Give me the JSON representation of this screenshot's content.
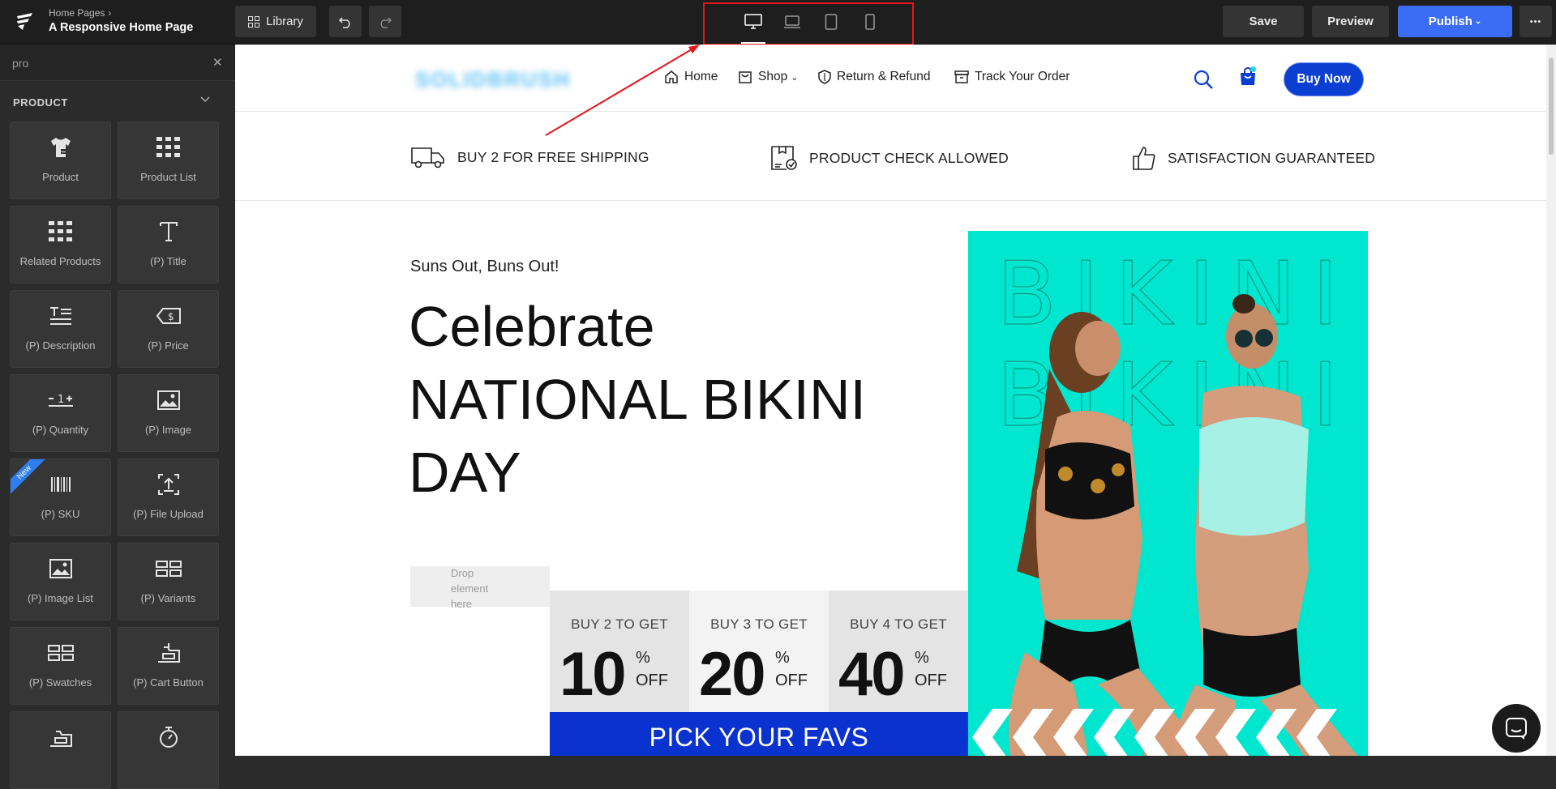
{
  "topbar": {
    "breadcrumb": "Home Pages",
    "title": "A Responsive Home Page",
    "library_label": "Library",
    "devices": [
      "desktop",
      "laptop",
      "tablet",
      "mobile"
    ],
    "active_device": "desktop",
    "save_label": "Save",
    "preview_label": "Preview",
    "publish_label": "Publish",
    "more_label": "•••"
  },
  "sidebar": {
    "search_value": "pro",
    "section_title": "PRODUCT",
    "tiles": [
      {
        "label": "Product",
        "icon": "tshirt-icon"
      },
      {
        "label": "Product List",
        "icon": "grid-list-icon"
      },
      {
        "label": "Related Products",
        "icon": "grid-icon"
      },
      {
        "label": "(P) Title",
        "icon": "title-icon"
      },
      {
        "label": "(P) Description",
        "icon": "description-icon"
      },
      {
        "label": "(P) Price",
        "icon": "price-tag-icon"
      },
      {
        "label": "(P) Quantity",
        "icon": "quantity-icon"
      },
      {
        "label": "(P) Image",
        "icon": "image-icon"
      },
      {
        "label": "(P) SKU",
        "icon": "barcode-icon",
        "badge": "New"
      },
      {
        "label": "(P) File Upload",
        "icon": "upload-icon"
      },
      {
        "label": "(P) Image List",
        "icon": "image-list-icon"
      },
      {
        "label": "(P) Variants",
        "icon": "variants-icon"
      },
      {
        "label": "(P) Swatches",
        "icon": "swatches-icon"
      },
      {
        "label": "(P) Cart Button",
        "icon": "cart-icon"
      },
      {
        "label": "",
        "icon": "cart-icon"
      },
      {
        "label": "",
        "icon": "timer-icon"
      }
    ]
  },
  "page": {
    "brand": "SOLIDBRUSH",
    "nav": {
      "home": "Home",
      "shop": "Shop",
      "return": "Return & Refund",
      "track": "Track Your Order"
    },
    "buy_now": "Buy Now",
    "features": [
      "BUY 2 FOR FREE SHIPPING",
      "PRODUCT CHECK ALLOWED",
      "SATISFACTION GUARANTEED"
    ],
    "kicker": "Suns Out, Buns Out!",
    "headline_lines": [
      "Celebrate",
      "NATIONAL BIKINI",
      "DAY"
    ],
    "drop_text": "Drop element here",
    "offers": [
      {
        "title": "BUY 2 TO GET",
        "value": "10",
        "pct": "%",
        "off": "OFF"
      },
      {
        "title": "BUY 3 TO GET",
        "value": "20",
        "pct": "%",
        "off": "OFF"
      },
      {
        "title": "BUY 4 TO GET",
        "value": "40",
        "pct": "%",
        "off": "OFF"
      }
    ],
    "cta": "PICK YOUR FAVS",
    "hero_text": "BIKINI"
  },
  "colors": {
    "accent": "#3b6cf6",
    "brand_blue": "#0a3fd1",
    "hero_bg": "#00e6cf",
    "annotation": "#e8141b"
  }
}
